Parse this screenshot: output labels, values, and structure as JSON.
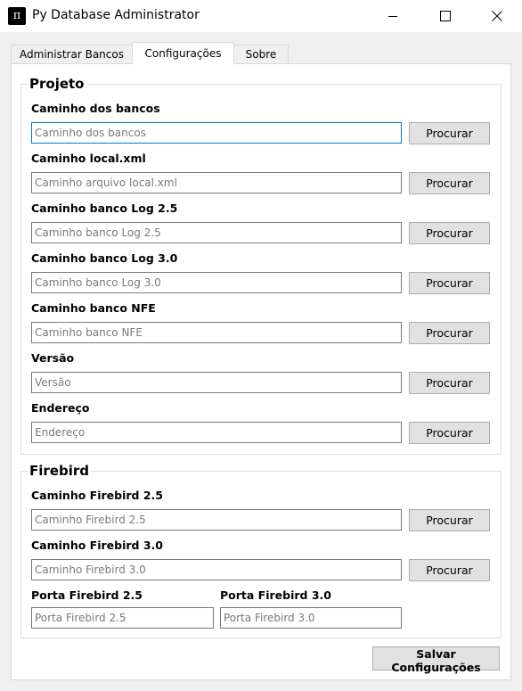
{
  "window": {
    "icon_glyph": "π",
    "title": "Py Database Administrator",
    "controls": {
      "minimize": "minimize",
      "maximize": "maximize",
      "close": "close"
    }
  },
  "tabs": [
    {
      "label": "Administrar Bancos",
      "active": false
    },
    {
      "label": "Configurações",
      "active": true
    },
    {
      "label": "Sobre",
      "active": false
    }
  ],
  "projeto": {
    "title": "Projeto",
    "rows": [
      {
        "label": "Caminho dos bancos",
        "placeholder": "Caminho dos bancos",
        "value": "",
        "button": "Procurar"
      },
      {
        "label": "Caminho local.xml",
        "placeholder": "Caminho arquivo local.xml",
        "value": "",
        "button": "Procurar"
      },
      {
        "label": "Caminho banco Log 2.5",
        "placeholder": "Caminho banco Log 2.5",
        "value": "",
        "button": "Procurar"
      },
      {
        "label": "Caminho banco Log 3.0",
        "placeholder": "Caminho banco Log 3.0",
        "value": "",
        "button": "Procurar"
      },
      {
        "label": "Caminho banco NFE",
        "placeholder": "Caminho banco NFE",
        "value": "",
        "button": "Procurar"
      },
      {
        "label": "Versão",
        "placeholder": "Versão",
        "value": "",
        "button": "Procurar"
      },
      {
        "label": "Endereço",
        "placeholder": "Endereço",
        "value": "",
        "button": "Procurar"
      }
    ]
  },
  "firebird": {
    "title": "Firebird",
    "rows": [
      {
        "label": "Caminho Firebird 2.5",
        "placeholder": "Caminho Firebird 2.5",
        "value": "",
        "button": "Procurar"
      },
      {
        "label": "Caminho Firebird 3.0",
        "placeholder": "Caminho Firebird 3.0",
        "value": "",
        "button": "Procurar"
      }
    ],
    "ports": [
      {
        "label": "Porta Firebird 2.5",
        "placeholder": "Porta Firebird 2.5",
        "value": ""
      },
      {
        "label": "Porta Firebird 3.0",
        "placeholder": "Porta Firebird 3.0",
        "value": ""
      }
    ]
  },
  "save_button": "Salvar Configurações",
  "colors": {
    "focus_border": "#0078d7",
    "button_bg": "#e1e1e1",
    "window_bg": "#f0f0f0"
  }
}
